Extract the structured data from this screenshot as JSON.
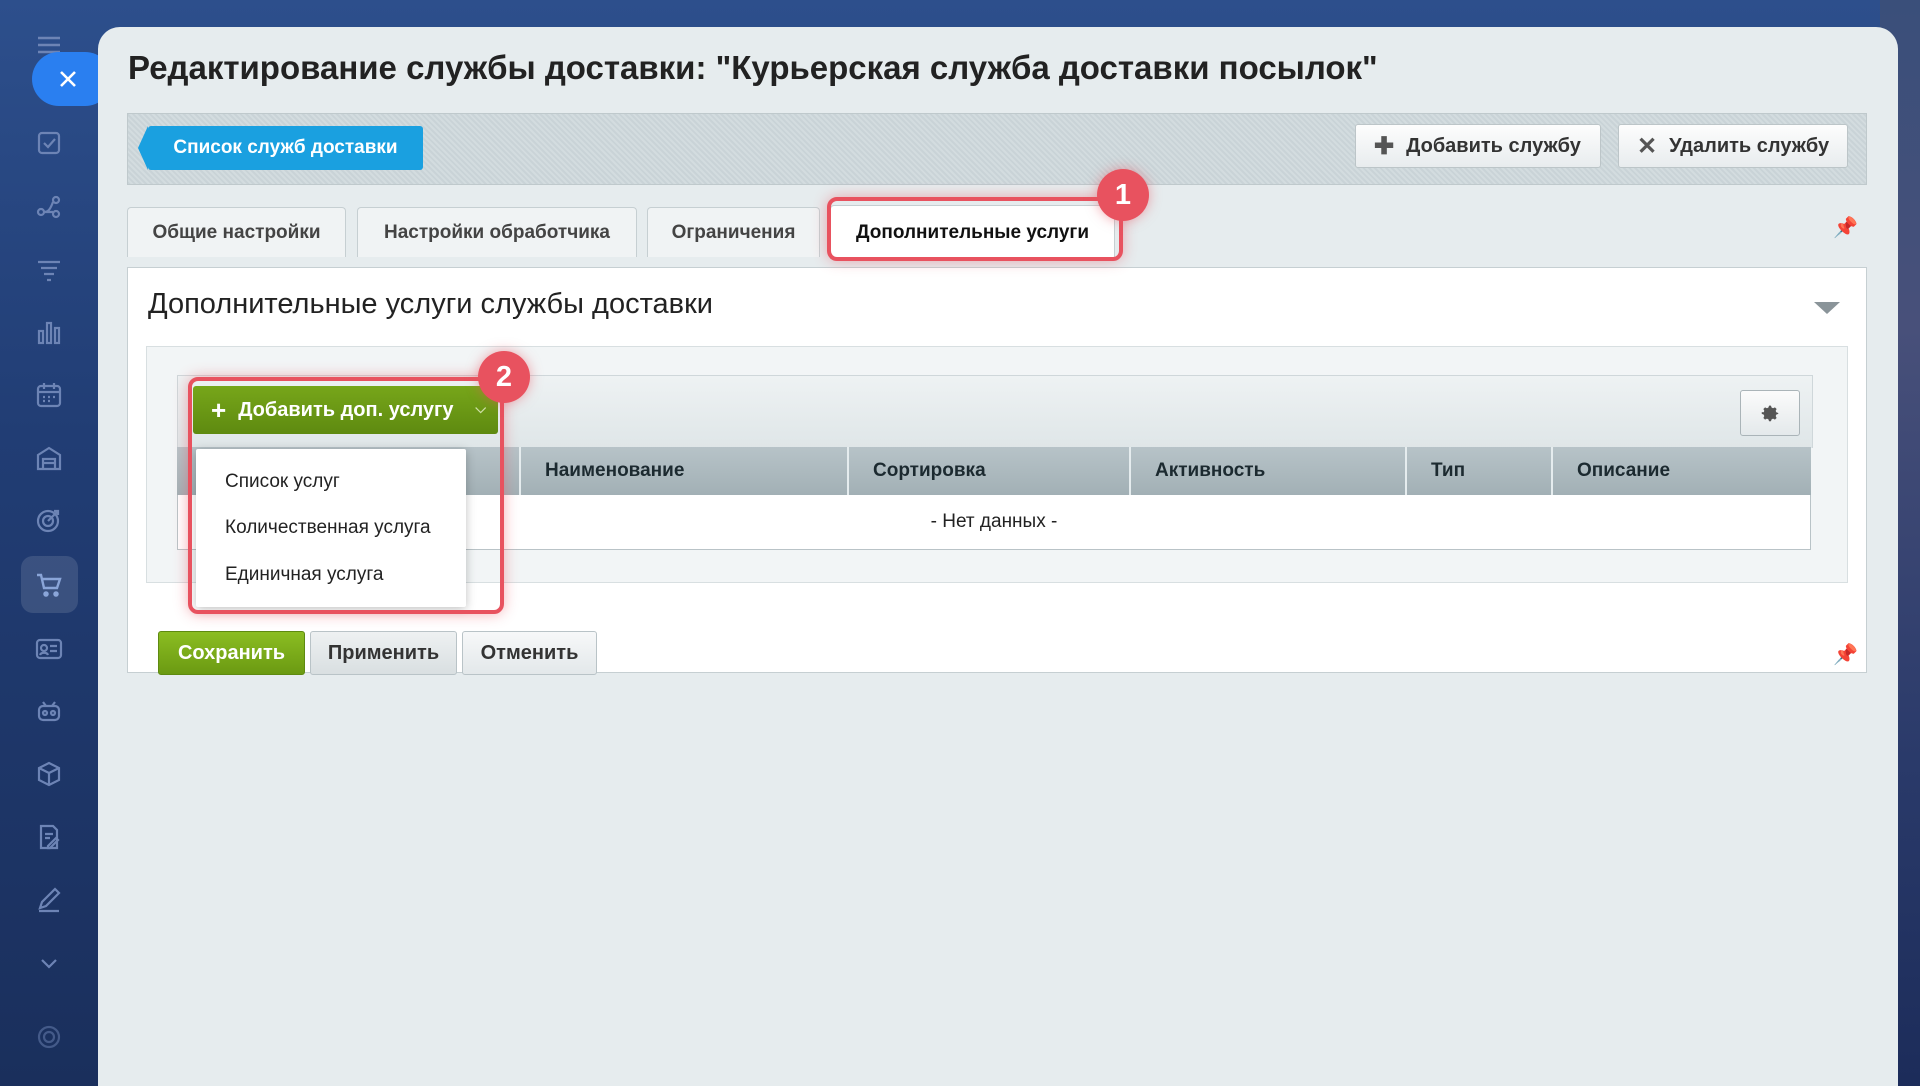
{
  "page": {
    "title": "Редактирование службы доставки: \"Курьерская служба доставки посылок\""
  },
  "toolbar": {
    "back_label": "Список служб доставки",
    "add_service_label": "Добавить службу",
    "delete_service_label": "Удалить службу"
  },
  "tabs": [
    {
      "label": "Общие настройки"
    },
    {
      "label": "Настройки обработчика"
    },
    {
      "label": "Ограничения"
    },
    {
      "label": "Дополнительные услуги"
    }
  ],
  "section": {
    "title": "Дополнительные услуги службы доставки",
    "add_button_label": "Добавить доп. услугу",
    "columns": [
      "Наименование",
      "Сортировка",
      "Активность",
      "Тип",
      "Описание"
    ],
    "empty_text": "- Нет данных -"
  },
  "dropdown": {
    "items": [
      "Список услуг",
      "Количественная услуга",
      "Единичная услуга"
    ]
  },
  "form_buttons": {
    "save": "Сохранить",
    "apply": "Применить",
    "cancel": "Отменить"
  },
  "annotations": {
    "badge1": "1",
    "badge2": "2"
  },
  "icons": {
    "sidebar": [
      "menu-icon",
      "close-icon",
      "checkbox-icon",
      "flow-icon",
      "filter-icon",
      "bar-chart-icon",
      "calendar-icon",
      "warehouse-icon",
      "target-icon",
      "cart-icon",
      "contact-card-icon",
      "robot-icon",
      "box-icon",
      "document-edit-icon",
      "pen-icon",
      "chevron-down-icon",
      "settings-icon"
    ]
  },
  "colors": {
    "accent_blue": "#1aa0e0",
    "accent_green": "#6b9a12",
    "annotation_red": "#e8525f"
  }
}
